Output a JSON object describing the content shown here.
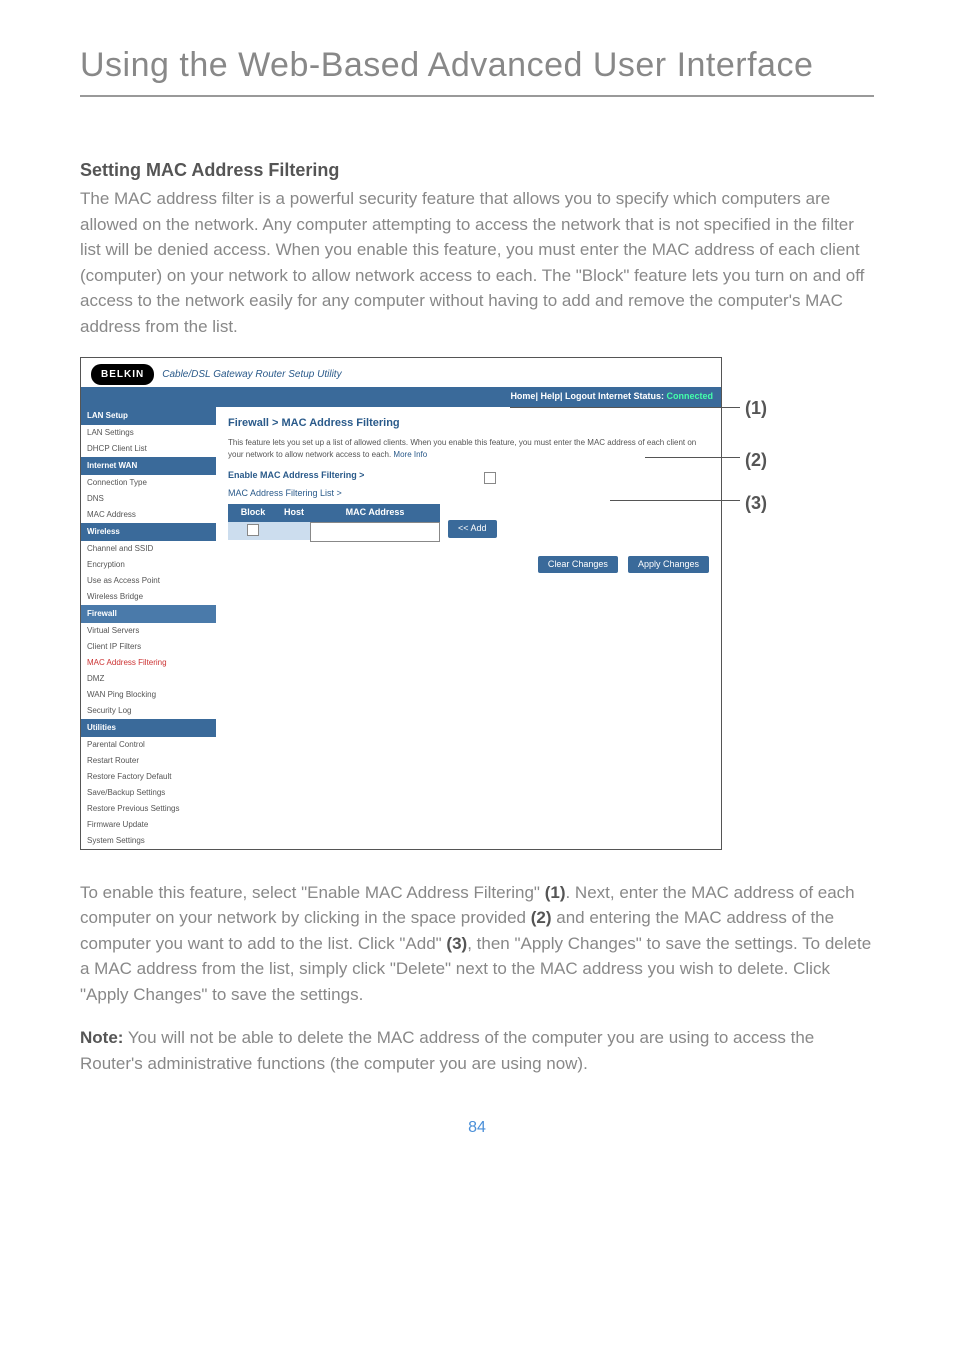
{
  "page": {
    "title": "Using the Web-Based Advanced User Interface",
    "section_heading": "Setting MAC Address Filtering",
    "intro_paragraph": "The MAC address filter is a powerful security feature that allows you to specify which computers are allowed on the network. Any computer attempting to access the network that is not specified in the filter list will be denied access. When you enable this feature, you must enter the MAC address of each client (computer) on your network to allow network access to each. The \"Block\" feature lets you turn on and off access to the network easily for any computer without having to add and remove the computer's MAC address from the list.",
    "outro_paragraph_1a": "To enable this feature, select \"Enable MAC Address Filtering\" ",
    "outro_ref1": "(1)",
    "outro_paragraph_1b": ". Next, enter the MAC address of each computer on your network by clicking in the space provided ",
    "outro_ref2": "(2)",
    "outro_paragraph_1c": " and entering the MAC address of the computer you want to add to the list. Click \"Add\" ",
    "outro_ref3": "(3)",
    "outro_paragraph_1d": ", then \"Apply Changes\" to save the settings. To delete a MAC address from the list, simply click \"Delete\" next to the MAC address you wish to delete. Click \"Apply Changes\" to save the settings.",
    "note_label": "Note:",
    "note_text": " You will not be able to delete the MAC address of the computer you are using to access the Router's administrative functions (the computer you are using now).",
    "page_number": "84"
  },
  "callouts": {
    "c1": "(1)",
    "c2": "(2)",
    "c3": "(3)"
  },
  "router": {
    "logo": "BELKIN",
    "tagline": "Cable/DSL Gateway Router Setup Utility",
    "topbar_links": "Home| Help| Logout   Internet Status:",
    "topbar_status": " Connected",
    "sidebar": {
      "sections": [
        {
          "header": "LAN Setup",
          "items": [
            "LAN Settings",
            "DHCP Client List"
          ]
        },
        {
          "header": "Internet WAN",
          "items": [
            "Connection Type",
            "DNS",
            "MAC Address"
          ]
        },
        {
          "header": "Wireless",
          "items": [
            "Channel and SSID",
            "Encryption",
            "Use as Access Point",
            "Wireless Bridge"
          ]
        },
        {
          "header": "Firewall",
          "items": [
            "Virtual Servers",
            "Client IP Filters",
            "MAC Address Filtering",
            "DMZ",
            "WAN Ping Blocking",
            "Security Log"
          ]
        },
        {
          "header": "Utilities",
          "items": [
            "Parental Control",
            "Restart Router",
            "Restore Factory Default",
            "Save/Backup Settings",
            "Restore Previous Settings",
            "Firmware Update",
            "System Settings"
          ]
        }
      ],
      "active_item": "MAC Address Filtering"
    },
    "content": {
      "title": "Firewall > MAC Address Filtering",
      "desc_a": "This feature lets you set up a list of allowed clients. When you enable this feature, you must enter the MAC address of each client on your network to allow network access to each. ",
      "desc_more": "More Info",
      "enable_label": "Enable MAC Address Filtering >",
      "filtlist_label": "MAC Address Filtering List >",
      "table_headers": {
        "block": "Block",
        "host": "Host",
        "mac": "MAC Address"
      },
      "add_btn": "<< Add",
      "clear_btn": "Clear Changes",
      "apply_btn": "Apply Changes"
    }
  }
}
